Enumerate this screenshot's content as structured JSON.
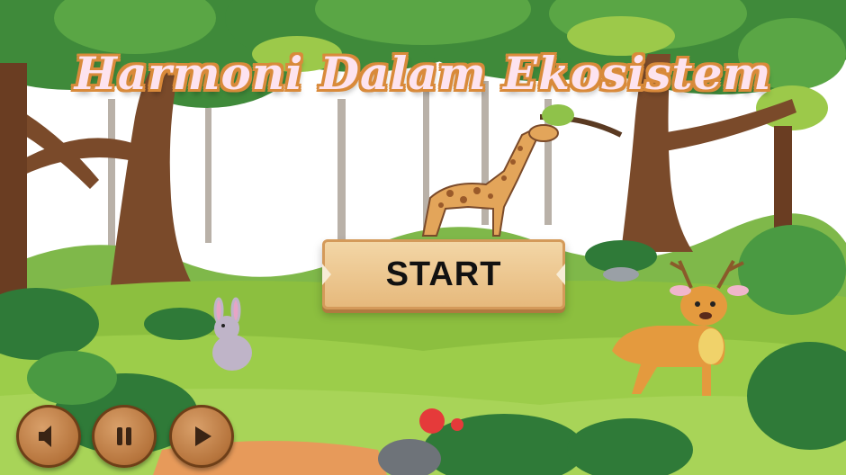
{
  "game": {
    "title": "Harmoni Dalam Ekosistem",
    "start_label": "START"
  },
  "controls": {
    "prev_icon": "sound-prev-icon",
    "pause_icon": "pause-icon",
    "play_icon": "play-icon"
  },
  "colors": {
    "sky": "#ffffff",
    "grass": "#8cbf3f",
    "title_fill": "#fde3ef",
    "title_outline": "#d98a3a",
    "wood": "#e6b97c",
    "button_wood": "#b6743c"
  }
}
